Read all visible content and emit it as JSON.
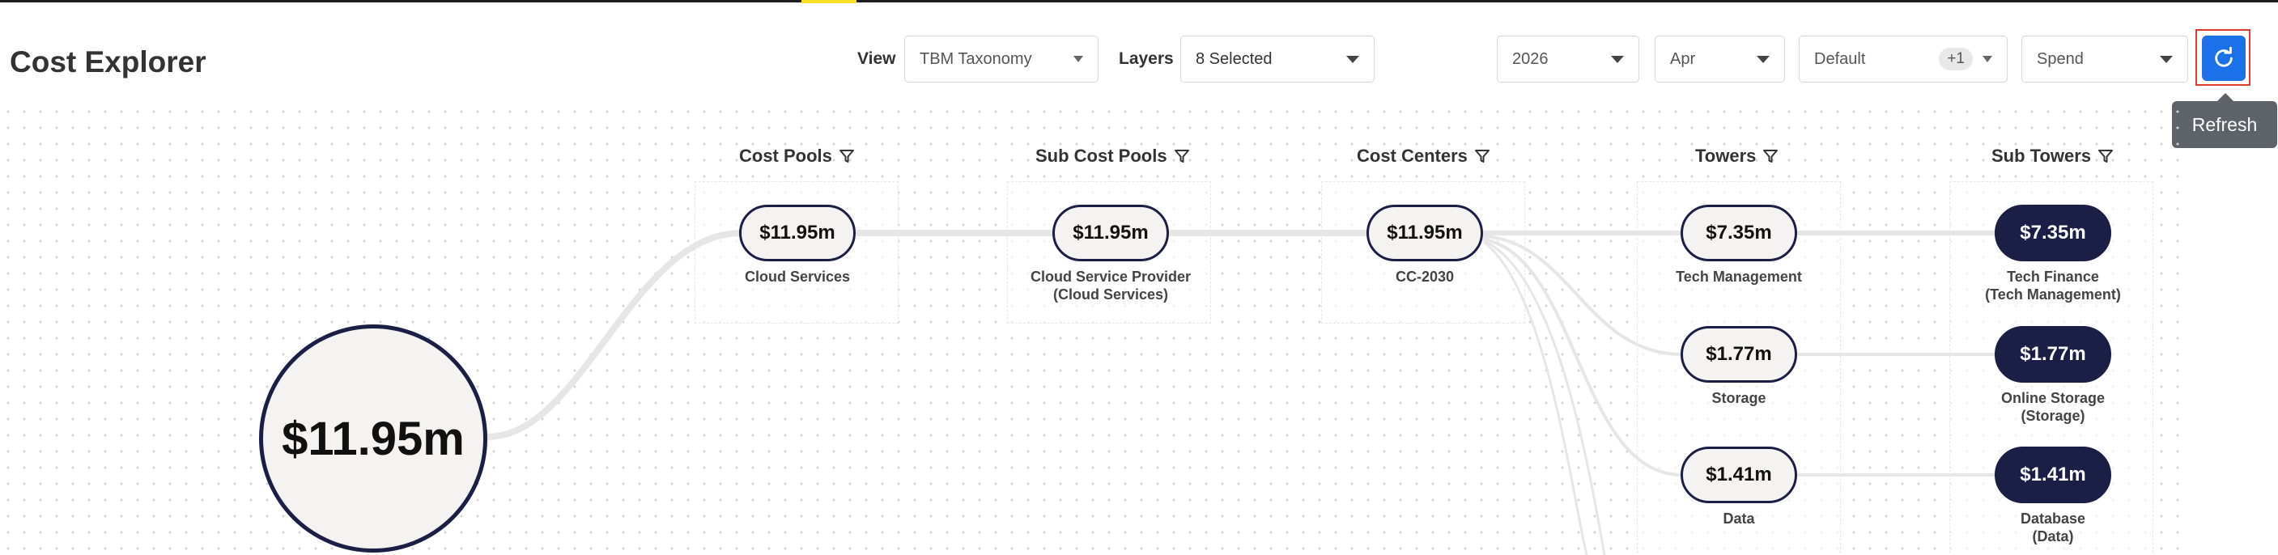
{
  "header": {
    "title": "Cost Explorer",
    "view_label": "View",
    "view_value": "TBM Taxonomy",
    "layers_label": "Layers",
    "layers_value": "8 Selected",
    "year_value": "2026",
    "month_value": "Apr",
    "scenario_value": "Default",
    "scenario_extra": "+1",
    "metric_value": "Spend",
    "refresh_tooltip": "Refresh"
  },
  "columns": [
    {
      "title": "Cost Pools"
    },
    {
      "title": "Sub Cost Pools"
    },
    {
      "title": "Cost Centers"
    },
    {
      "title": "Towers"
    },
    {
      "title": "Sub Towers"
    }
  ],
  "total": {
    "value": "$11.95m"
  },
  "nodes": {
    "cost_pool": {
      "value": "$11.95m",
      "label": "Cloud Services"
    },
    "sub_cost_pool": {
      "value": "$11.95m",
      "label_line1": "Cloud Service Provider",
      "label_line2": "(Cloud Services)"
    },
    "cost_center": {
      "value": "$11.95m",
      "label": "CC-2030"
    },
    "towers": [
      {
        "value": "$7.35m",
        "label": "Tech Management"
      },
      {
        "value": "$1.77m",
        "label": "Storage"
      },
      {
        "value": "$1.41m",
        "label": "Data"
      }
    ],
    "sub_towers": [
      {
        "value": "$7.35m",
        "label_line1": "Tech Finance",
        "label_line2": "(Tech Management)"
      },
      {
        "value": "$1.77m",
        "label_line1": "Online Storage",
        "label_line2": "(Storage)"
      },
      {
        "value": "$1.41m",
        "label_line1": "Database",
        "label_line2": "(Data)"
      }
    ]
  },
  "colors": {
    "node_border": "#1b1f45",
    "node_fill": "#f4f3f1",
    "accent_button": "#1b72e8",
    "highlight_outline": "#e03a2e"
  },
  "icons": [
    "filter-icon",
    "refresh-icon",
    "chevron-down-icon"
  ]
}
